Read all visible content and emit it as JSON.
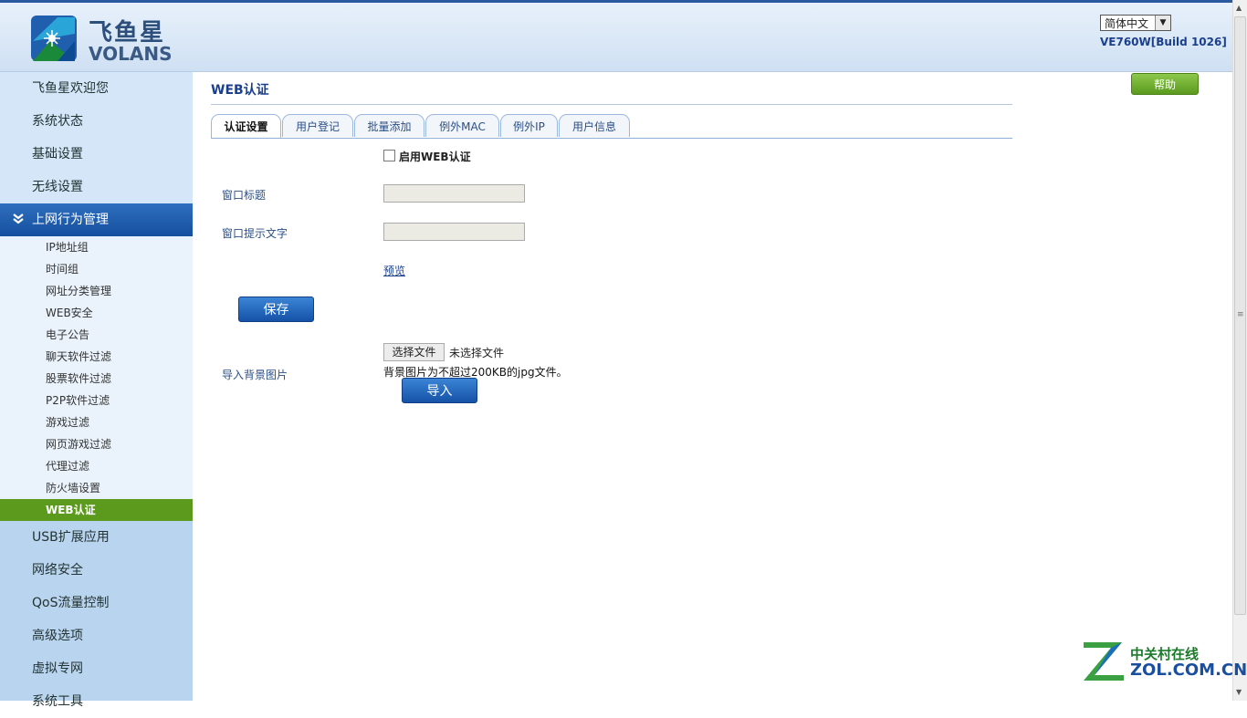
{
  "header": {
    "brand_text": "飞鱼星",
    "brand_latin": "VOLANS",
    "language": "简体中文",
    "version": "VE760W[Build 1026]",
    "help_label": "帮助"
  },
  "sidebar": {
    "top_items": [
      "飞鱼星欢迎您",
      "系统状态",
      "基础设置",
      "无线设置"
    ],
    "active_group": "上网行为管理",
    "sub_items": [
      "IP地址组",
      "时间组",
      "网址分类管理",
      "WEB安全",
      "电子公告",
      "聊天软件过滤",
      "股票软件过滤",
      "P2P软件过滤",
      "游戏过滤",
      "网页游戏过滤",
      "代理过滤",
      "防火墙设置",
      "WEB认证"
    ],
    "active_sub": "WEB认证",
    "bottom_items": [
      "USB扩展应用",
      "网络安全",
      "QoS流量控制",
      "高级选项",
      "虚拟专网",
      "系统工具"
    ]
  },
  "main": {
    "title": "WEB认证",
    "tabs": [
      "认证设置",
      "用户登记",
      "批量添加",
      "例外MAC",
      "例外IP",
      "用户信息"
    ],
    "active_tab": "认证设置",
    "enable_label": "启用WEB认证",
    "enable_checked": false,
    "window_title_label": "窗口标题",
    "window_title_value": "",
    "window_tip_label": "窗口提示文字",
    "window_tip_value": "",
    "preview_link": "预览",
    "save_label": "保存",
    "import_bg_label": "导入背景图片",
    "choose_file_label": "选择文件",
    "file_status": "未选择文件",
    "hint_text": "背景图片为不超过200KB的jpg文件。",
    "import_label": "导入"
  },
  "watermark": {
    "cn": "中关村在线",
    "en": "ZOL.COM.CN"
  },
  "colors": {
    "accent_blue": "#1552a8",
    "active_green": "#5c9a1e",
    "sidebar_bg": "#d5e6f8"
  }
}
